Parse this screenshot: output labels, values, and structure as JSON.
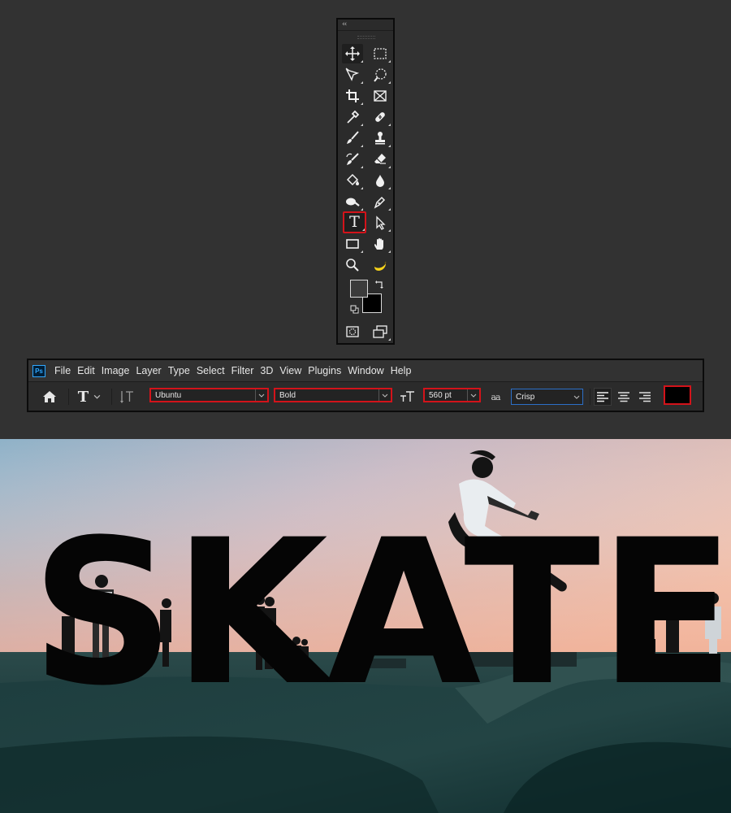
{
  "toolbar": {
    "collapse_label": "‹‹",
    "tools": [
      {
        "left": "move-icon",
        "right": "marquee-icon"
      },
      {
        "left": "artboard-icon",
        "right": "quick-select-icon"
      },
      {
        "left": "crop-icon",
        "right": "frame-icon"
      },
      {
        "left": "eyedropper-icon",
        "right": "healing-icon"
      },
      {
        "left": "brush-icon",
        "right": "stamp-icon"
      },
      {
        "left": "history-brush-icon",
        "right": "eraser-icon"
      },
      {
        "left": "paint-bucket-icon",
        "right": "blur-icon"
      },
      {
        "left": "dodge-icon",
        "right": "pen-icon"
      },
      {
        "left": "type-icon",
        "right": "path-select-icon"
      },
      {
        "left": "rectangle-icon",
        "right": "hand-icon"
      },
      {
        "left": "zoom-icon",
        "right": "banana-icon"
      }
    ],
    "type_tool_glyph": "T",
    "selected_tool": "type-icon"
  },
  "menubar": {
    "logo": "Ps",
    "items": [
      "File",
      "Edit",
      "Image",
      "Layer",
      "Type",
      "Select",
      "Filter",
      "3D",
      "View",
      "Plugins",
      "Window",
      "Help"
    ]
  },
  "options": {
    "tool_glyph": "T",
    "font_family": "Ubuntu",
    "font_style": "Bold",
    "font_size": "560 pt",
    "antialias_glyph": "aa",
    "antialias": "Crisp",
    "alignment": "left",
    "text_color": "#000000"
  },
  "canvas": {
    "text": "SKATE"
  },
  "colors": {
    "highlight_red": "#d3131a",
    "panel": "#2b2b2b",
    "background": "#323232"
  }
}
